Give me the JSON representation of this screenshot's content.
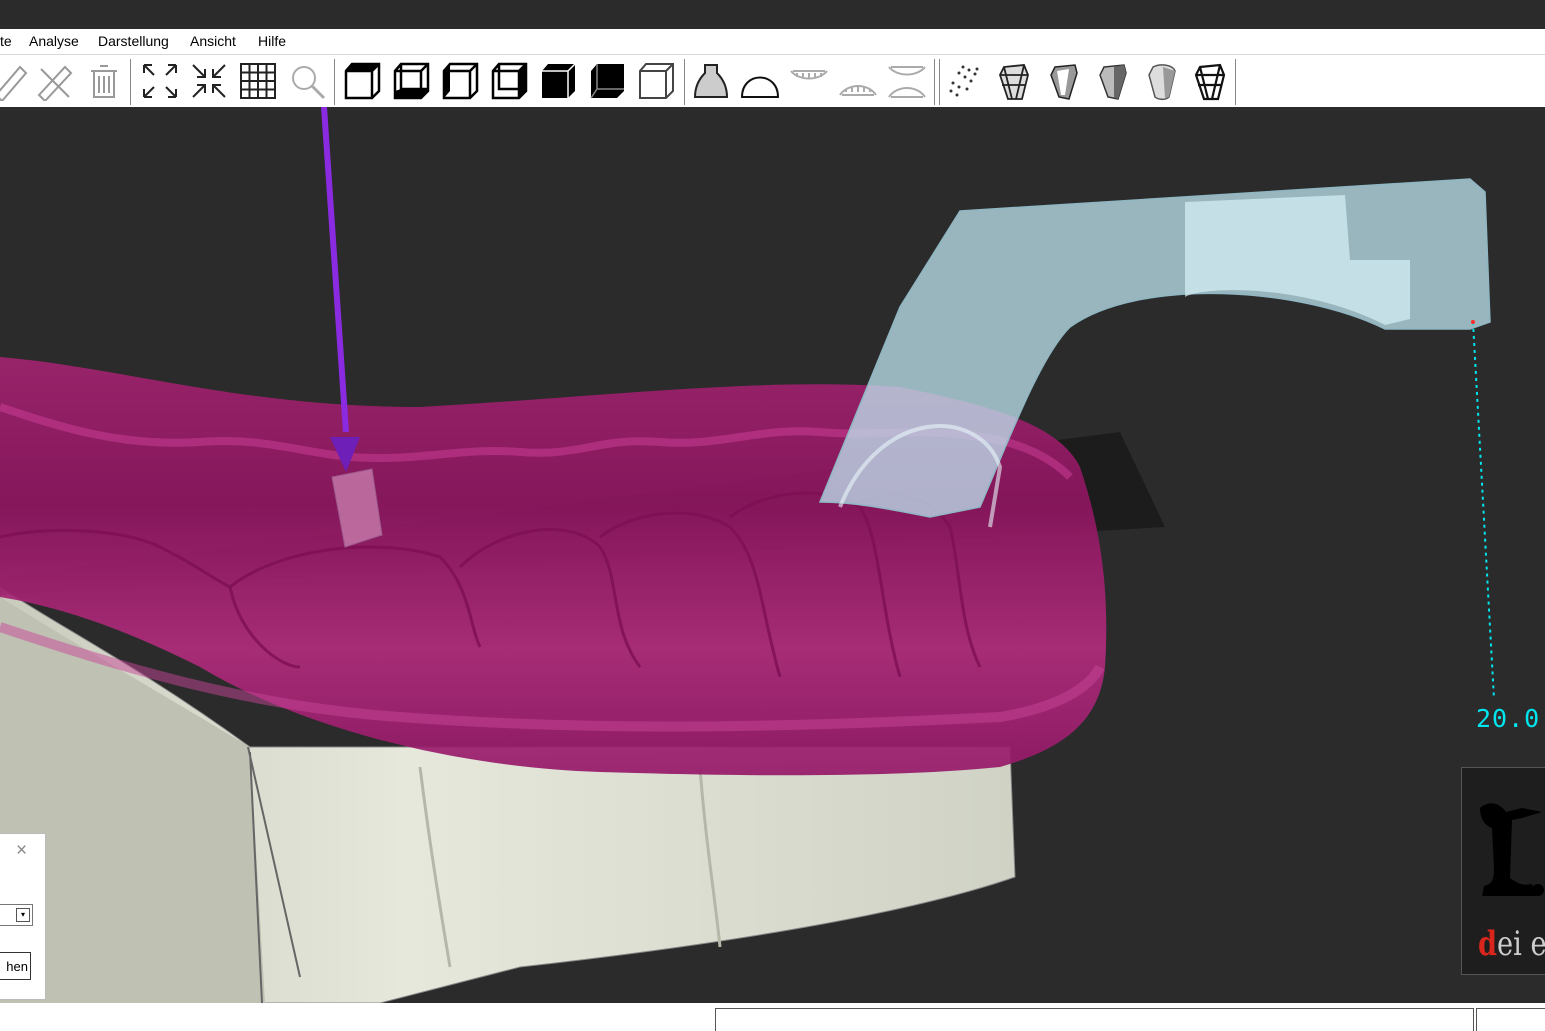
{
  "menubar": {
    "items": [
      {
        "label": "te"
      },
      {
        "label": "Analyse"
      },
      {
        "label": "Darstellung"
      },
      {
        "label": "Ansicht"
      },
      {
        "label": "Hilfe"
      }
    ]
  },
  "toolbar": {
    "groups": [
      [
        "ruler-icon",
        "scissors-ruler-icon",
        "trash-icon"
      ],
      [
        "zoom-extents-icon",
        "zoom-fit-icon",
        "grid-icon",
        "magnifier-icon"
      ],
      [
        "view-front-icon",
        "view-back-icon",
        "view-left-icon",
        "view-right-icon",
        "view-top-icon",
        "view-bottom-icon",
        "view-iso-icon"
      ],
      [
        "impression-icon",
        "dome-icon",
        "upper-jaw-icon",
        "lower-jaw-icon",
        "both-jaws-icon"
      ],
      [
        "point-cloud-icon",
        "mesh-tooth-icon",
        "tooth-shell-icon",
        "tooth-solid-icon",
        "tooth-smooth-icon",
        "tooth-wire-icon"
      ]
    ]
  },
  "viewport": {
    "measurement_label": "20.0",
    "colors": {
      "background": "#2b2b2b",
      "gingiva": "#b0267e",
      "model": "#d9dccf",
      "bracket": "#bfe6f0",
      "axis": "#8a2be2",
      "measure": "#00e5ee"
    }
  },
  "logo": {
    "accent": "d",
    "text": "ei e"
  },
  "dialog": {
    "close": "×",
    "button_label": "hen",
    "dropdown_arrow": "▾"
  }
}
